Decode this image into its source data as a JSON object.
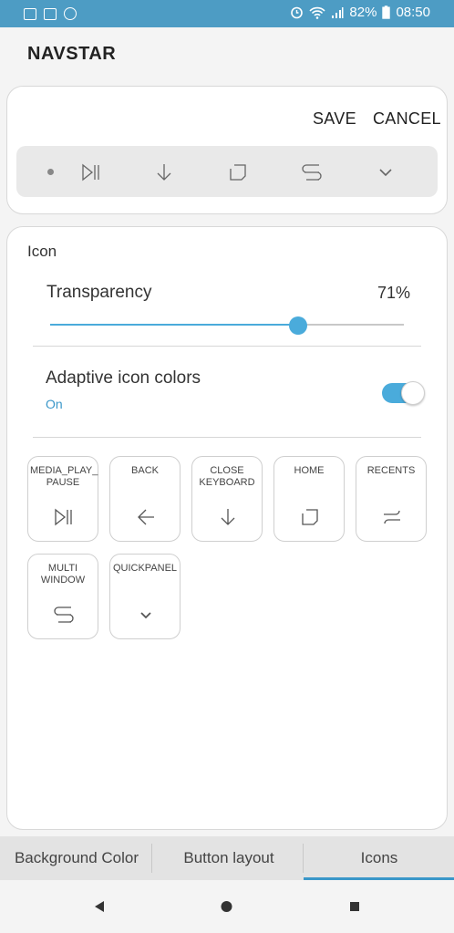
{
  "status": {
    "battery": "82%",
    "time": "08:50"
  },
  "app": {
    "title": "NAVSTAR"
  },
  "editor": {
    "save_label": "SAVE",
    "cancel_label": "CANCEL"
  },
  "icon_section": {
    "title": "Icon",
    "transparency_label": "Transparency",
    "transparency_value": "71%",
    "transparency_fraction": 0.7,
    "adaptive_label": "Adaptive icon colors",
    "adaptive_state": "On",
    "adaptive_on": true
  },
  "buttons": [
    {
      "label": "MEDIA_PLAY_\nPAUSE",
      "icon": "play-pause-icon"
    },
    {
      "label": "BACK",
      "icon": "back-arrow-icon"
    },
    {
      "label": "CLOSE\nKEYBOARD",
      "icon": "close-keyboard-icon"
    },
    {
      "label": "HOME",
      "icon": "home-square-icon"
    },
    {
      "label": "RECENTS",
      "icon": "recents-icon"
    },
    {
      "label": "MULTI\nWINDOW",
      "icon": "multi-window-icon"
    },
    {
      "label": "QUICKPANEL",
      "icon": "chevron-down-icon"
    }
  ],
  "tabs": [
    {
      "label": "Background Color"
    },
    {
      "label": "Button layout"
    },
    {
      "label": "Icons"
    }
  ],
  "colors": {
    "accent": "#4aabdb",
    "statusbar": "#4d9cc4"
  }
}
